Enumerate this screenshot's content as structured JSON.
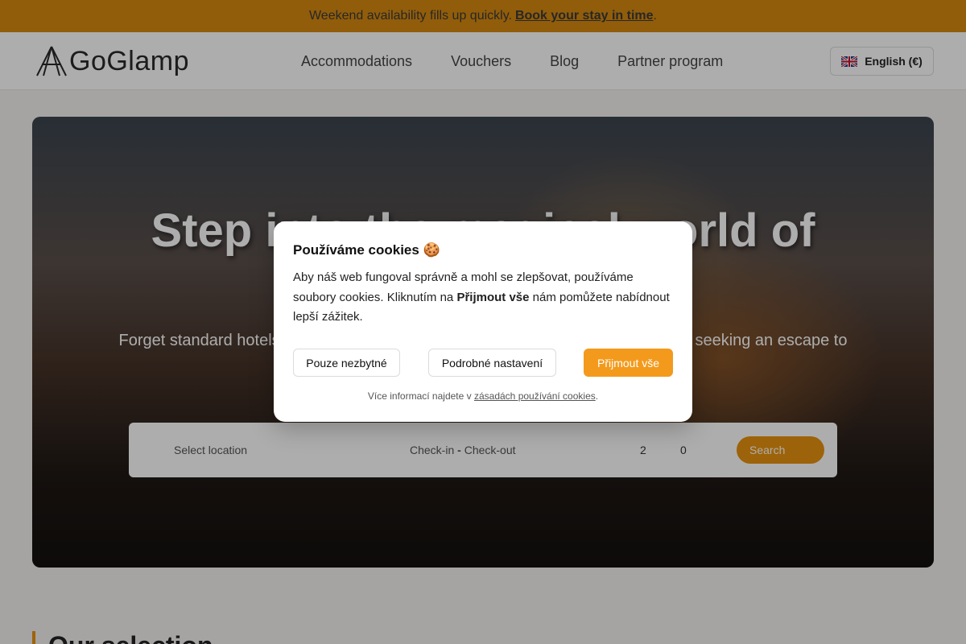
{
  "promo": {
    "text": "Weekend availability fills up quickly.",
    "link": "Book your stay in time ",
    "tail": "."
  },
  "header": {
    "logo_text": "GoGlamp",
    "nav": [
      "Accommodations",
      "Vouchers",
      "Blog",
      "Partner program"
    ],
    "language": "English (€)"
  },
  "hero": {
    "title": "Step into the magical world of",
    "subtitle": "Forget standard hotels — discover unique glamping accommodations. For those seeking an escape to nature, we offer the best glamping stays in Czechia and"
  },
  "search": {
    "location_placeholder": "Select location",
    "checkin": "Check-in",
    "separator": "-",
    "checkout": "Check-out",
    "adults": "2",
    "children": "0",
    "button": "Search"
  },
  "section": {
    "title": "Our selection"
  },
  "cookie_modal": {
    "title": "Používáme cookies 🍪",
    "body_part1": "Aby náš web fungoval správně a mohl se zlepšovat, používáme soubory cookies. Kliknutím na ",
    "body_bold": "Přijmout vše",
    "body_part2": " nám pomůžete nabídnout lepší zážitek.",
    "btn_necessary": "Pouze nezbytné",
    "btn_settings": "Podrobné nastavení",
    "btn_accept": "Přijmout vše",
    "foot_text": "Více informací najdete v ",
    "foot_link": "zásadách používání cookies",
    "foot_tail": "."
  },
  "colors": {
    "accent": "#e8920f",
    "promo_bg": "#d68a10",
    "accept_btn": "#f39a1c"
  },
  "icons": {
    "logo": "tent-logo-icon",
    "flag": "uk-flag-icon"
  }
}
